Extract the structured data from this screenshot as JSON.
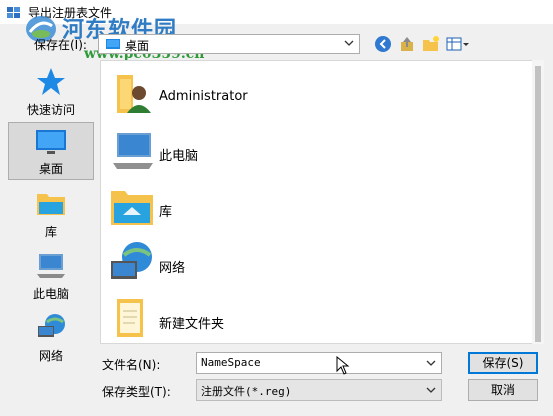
{
  "window": {
    "title": "导出注册表文件"
  },
  "watermark": {
    "site_name": "河东软件园",
    "url": "www.pc0359.cn"
  },
  "toolbar": {
    "save_in_label": "保存在(I):",
    "save_in_value": "桌面"
  },
  "places": [
    {
      "label": "快速访问",
      "icon": "star-icon",
      "selected": false
    },
    {
      "label": "桌面",
      "icon": "desktop-icon",
      "selected": true
    },
    {
      "label": "库",
      "icon": "library-icon",
      "selected": false
    },
    {
      "label": "此电脑",
      "icon": "computer-icon",
      "selected": false
    },
    {
      "label": "网络",
      "icon": "network-icon",
      "selected": false
    }
  ],
  "files": [
    {
      "name": "Administrator",
      "icon": "user-folder-icon"
    },
    {
      "name": "此电脑",
      "icon": "computer-icon"
    },
    {
      "name": "库",
      "icon": "library-icon"
    },
    {
      "name": "网络",
      "icon": "network-icon"
    },
    {
      "name": "新建文件夹",
      "icon": "folder-icon"
    }
  ],
  "form": {
    "filename_label": "文件名(N):",
    "filename_value": "NameSpace",
    "filetype_label": "保存类型(T):",
    "filetype_value": "注册文件(*.reg)",
    "save_button": "保存(S)",
    "cancel_button": "取消"
  },
  "colors": {
    "accent": "#0078d7",
    "folder": "#f5c24c",
    "watermark_blue": "#2f7bc4",
    "watermark_green": "#2f9a3a"
  }
}
